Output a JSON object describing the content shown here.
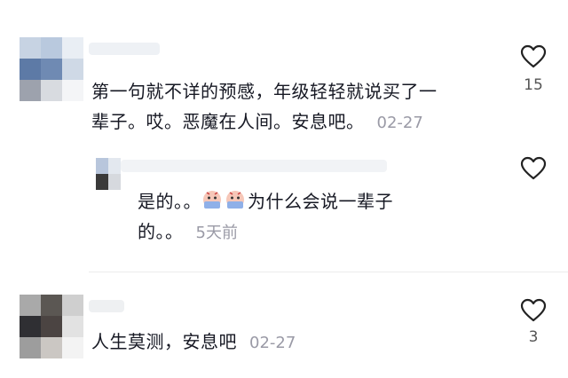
{
  "comments": [
    {
      "text_line1": "第一句就不详的预感，年级轻轻就说买了一",
      "text_line2": "辈子。哎。恶魔在人间。安息吧。",
      "date": "02-27",
      "likes": "15",
      "replies": [
        {
          "text_line1": "是的。。",
          "text_line1b": "为什么会说一辈子",
          "text_line2": "的。。",
          "date": "5天前",
          "emoji": [
            "crying-face-emoji",
            "crying-face-emoji"
          ],
          "likes": ""
        }
      ]
    },
    {
      "text": "人生莫测，安息吧",
      "date": "02-27",
      "likes": "3"
    }
  ],
  "icons": {
    "like": "heart-outline-icon"
  },
  "colors": {
    "text": "#161823",
    "meta": "#9a9aa6",
    "icon": "#222222"
  }
}
